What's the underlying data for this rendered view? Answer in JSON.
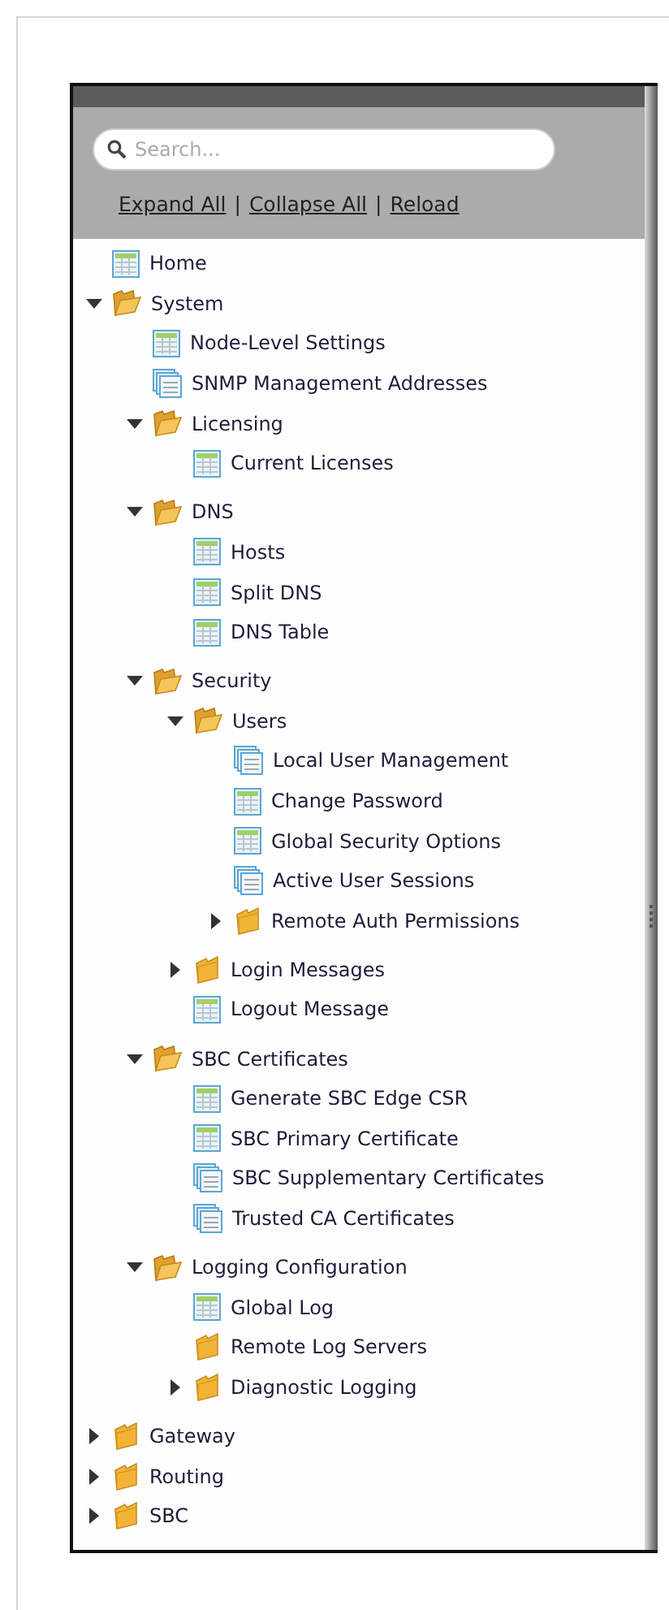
{
  "search": {
    "placeholder": "Search..."
  },
  "links": [
    "Expand All",
    "Collapse All",
    "Reload"
  ],
  "link_separator": "|",
  "tree": [
    {
      "label": "Home",
      "kind": "page"
    },
    {
      "label": "System",
      "kind": "folder",
      "expandable": true,
      "expanded": true,
      "children": [
        {
          "label": "Node-Level Settings",
          "kind": "page"
        },
        {
          "label": "SNMP Management Addresses",
          "kind": "pages"
        },
        {
          "label": "Licensing",
          "kind": "folder",
          "expandable": true,
          "expanded": true,
          "children": [
            {
              "label": "Current Licenses",
              "kind": "page"
            }
          ]
        },
        {
          "label": "DNS",
          "kind": "folder",
          "expandable": true,
          "expanded": true,
          "children": [
            {
              "label": "Hosts",
              "kind": "page"
            },
            {
              "label": "Split DNS",
              "kind": "page"
            },
            {
              "label": "DNS Table",
              "kind": "page"
            }
          ]
        },
        {
          "label": "Security",
          "kind": "folder",
          "expandable": true,
          "expanded": true,
          "children": [
            {
              "label": "Users",
              "kind": "folder",
              "expandable": true,
              "expanded": true,
              "children": [
                {
                  "label": "Local User Management",
                  "kind": "pages"
                },
                {
                  "label": "Change Password",
                  "kind": "page"
                },
                {
                  "label": "Global Security Options",
                  "kind": "page"
                },
                {
                  "label": "Active User Sessions",
                  "kind": "pages"
                },
                {
                  "label": "Remote Auth Permissions",
                  "kind": "folder",
                  "expandable": true,
                  "expanded": false
                }
              ]
            },
            {
              "label": "Login Messages",
              "kind": "folder",
              "expandable": true,
              "expanded": false
            },
            {
              "label": "Logout Message",
              "kind": "page"
            }
          ]
        },
        {
          "label": "SBC Certificates",
          "kind": "folder",
          "expandable": true,
          "expanded": true,
          "children": [
            {
              "label": "Generate SBC Edge CSR",
              "kind": "page"
            },
            {
              "label": "SBC Primary Certificate",
              "kind": "page"
            },
            {
              "label": "SBC Supplementary Certificates",
              "kind": "pages"
            },
            {
              "label": "Trusted CA Certificates",
              "kind": "pages"
            }
          ]
        },
        {
          "label": "Logging Configuration",
          "kind": "folder",
          "expandable": true,
          "expanded": true,
          "children": [
            {
              "label": "Global Log",
              "kind": "page"
            },
            {
              "label": "Remote Log Servers",
              "kind": "folder",
              "expandable": false,
              "expanded": false
            },
            {
              "label": "Diagnostic Logging",
              "kind": "folder",
              "expandable": true,
              "expanded": false
            }
          ]
        }
      ]
    },
    {
      "label": "Gateway",
      "kind": "folder",
      "expandable": true,
      "expanded": false
    },
    {
      "label": "Routing",
      "kind": "folder",
      "expandable": true,
      "expanded": false
    },
    {
      "label": "SBC",
      "kind": "folder",
      "expandable": true,
      "expanded": false
    }
  ]
}
